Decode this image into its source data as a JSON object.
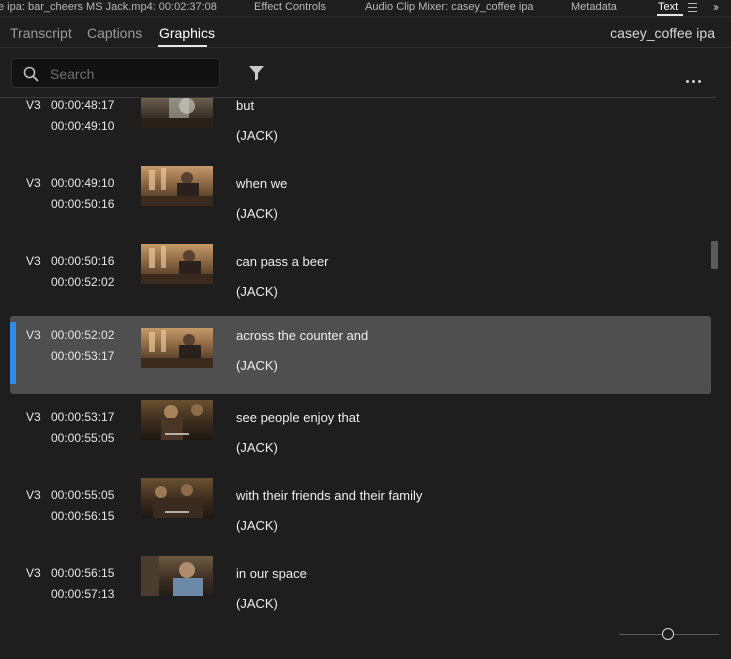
{
  "panel_tabs": [
    {
      "label": "e ipa: bar_cheers MS Jack.mp4: 00:02:37:08",
      "active": false
    },
    {
      "label": "Effect Controls",
      "active": false
    },
    {
      "label": "Audio Clip Mixer: casey_coffee ipa",
      "active": false
    },
    {
      "label": "Metadata",
      "active": false
    },
    {
      "label": "Text",
      "active": true
    }
  ],
  "sub_tabs": [
    {
      "label": "Transcript",
      "active": false
    },
    {
      "label": "Captions",
      "active": false
    },
    {
      "label": "Graphics",
      "active": true
    }
  ],
  "sequence_name": "casey_coffee ipa",
  "search": {
    "placeholder": "Search",
    "value": ""
  },
  "icons": {
    "panel_menu": "hamburger-menu-icon",
    "overflow": "double-chevron-right-icon",
    "search": "magnifier-icon",
    "filter": "funnel-icon",
    "more": "ellipsis-icon"
  },
  "colors": {
    "selection_marker": "#2d8ceb",
    "selected_row": "#4f4f4f",
    "background": "#1e1e1e"
  },
  "captions": [
    {
      "track": "V3",
      "in": "00:00:48:17",
      "out": "00:00:49:10",
      "text": "but",
      "speaker": "(JACK)",
      "selected": false
    },
    {
      "track": "V3",
      "in": "00:00:49:10",
      "out": "00:00:50:16",
      "text": "when we",
      "speaker": "(JACK)",
      "selected": false
    },
    {
      "track": "V3",
      "in": "00:00:50:16",
      "out": "00:00:52:02",
      "text": "can pass a beer",
      "speaker": "(JACK)",
      "selected": false
    },
    {
      "track": "V3",
      "in": "00:00:52:02",
      "out": "00:00:53:17",
      "text": "across the counter and",
      "speaker": "(JACK)",
      "selected": true
    },
    {
      "track": "V3",
      "in": "00:00:53:17",
      "out": "00:00:55:05",
      "text": "see people enjoy that",
      "speaker": "(JACK)",
      "selected": false
    },
    {
      "track": "V3",
      "in": "00:00:55:05",
      "out": "00:00:56:15",
      "text": "with their friends and their family",
      "speaker": "(JACK)",
      "selected": false
    },
    {
      "track": "V3",
      "in": "00:00:56:15",
      "out": "00:00:57:13",
      "text": "in our space",
      "speaker": "(JACK)",
      "selected": false
    }
  ]
}
